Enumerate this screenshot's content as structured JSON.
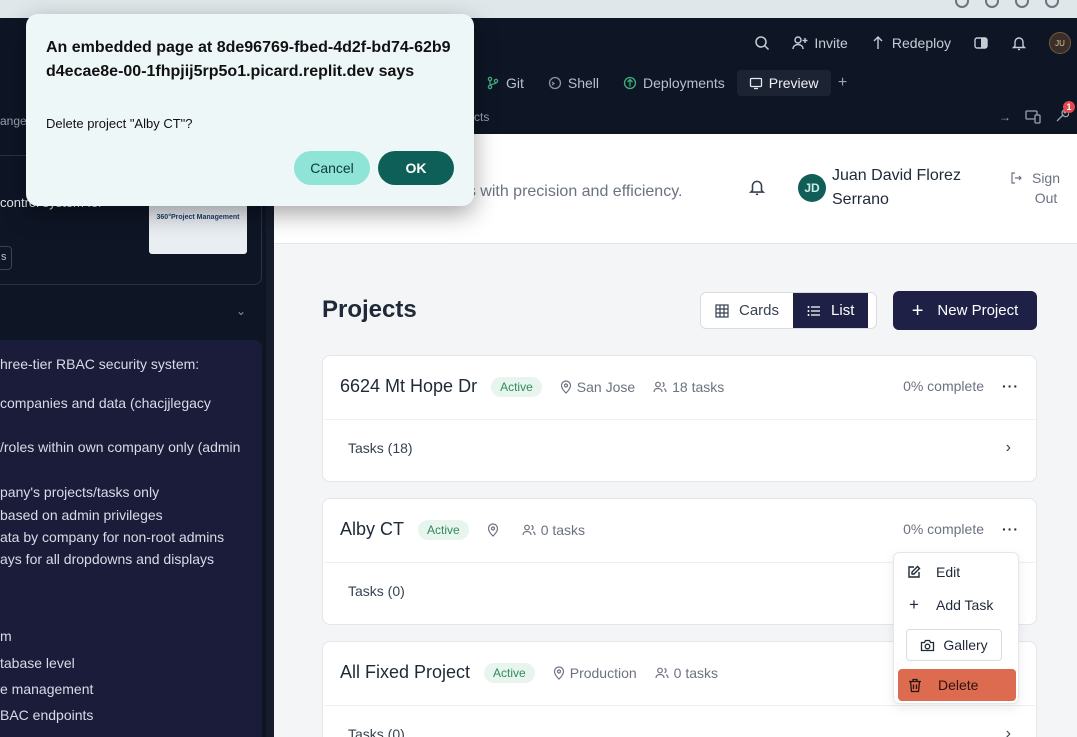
{
  "dialog": {
    "title": "An embedded page at 8de96769-fbed-4d2f-bd74-62b9d4ecae8e-00-1fhpjij5rp5o1.picard.replit.dev says",
    "message": "Delete project \"Alby CT\"?",
    "cancel_label": "Cancel",
    "ok_label": "OK"
  },
  "replit": {
    "invite_label": "Invite",
    "redeploy_label": "Redeploy",
    "avatar_initials": "JU",
    "tabs": [
      {
        "label": "Git",
        "icon": "git-icon"
      },
      {
        "label": "Shell",
        "icon": "shell-icon"
      },
      {
        "label": "Deployments",
        "icon": "deployments-icon"
      },
      {
        "label": "Preview",
        "icon": "preview-icon"
      }
    ],
    "url_tail": "cts",
    "notification_count": "1"
  },
  "left_panel": {
    "partial_top": "ange",
    "partial_control": "control system for",
    "thumb_title": "360°Project Management",
    "chip_text": "s",
    "lines": [
      "hree-tier RBAC security system:",
      "companies and data (chacjjlegacy",
      "/roles within own company only (admin",
      "pany's projects/tasks only",
      "based on admin privileges",
      "ata by company for non-root admins",
      "ays for all dropdowns and displays",
      "m",
      "tabase level",
      "e management",
      "BAC endpoints"
    ]
  },
  "app": {
    "subtitle": "nstruction projects with precision and efficiency.",
    "user_initials": "JD",
    "user_name": "Juan David Florez Serrano",
    "sign_out_label": "Sign Out",
    "page_title": "Projects",
    "view_cards_label": "Cards",
    "view_list_label": "List",
    "new_project_label": "New Project"
  },
  "projects": [
    {
      "name": "6624 Mt Hope Dr",
      "status": "Active",
      "location": "San Jose",
      "tasks": "18 tasks",
      "complete": "0% complete",
      "tasks_row": "Tasks (18)"
    },
    {
      "name": "Alby CT",
      "status": "Active",
      "location": "",
      "tasks": "0 tasks",
      "complete": "0% complete",
      "tasks_row": "Tasks (0)"
    },
    {
      "name": "All Fixed Project",
      "status": "Active",
      "location": "Production",
      "tasks": "0 tasks",
      "complete": "",
      "tasks_row": "Tasks (0)"
    }
  ],
  "context_menu": {
    "edit_label": "Edit",
    "add_task_label": "Add Task",
    "gallery_label": "Gallery",
    "delete_label": "Delete"
  },
  "colors": {
    "accent_navy": "#1e2046",
    "status_green": "#2f8a5a",
    "delete_red": "#dc6b4f",
    "dialog_ok": "#0e5f58",
    "dialog_cancel": "#8ee4d7"
  }
}
